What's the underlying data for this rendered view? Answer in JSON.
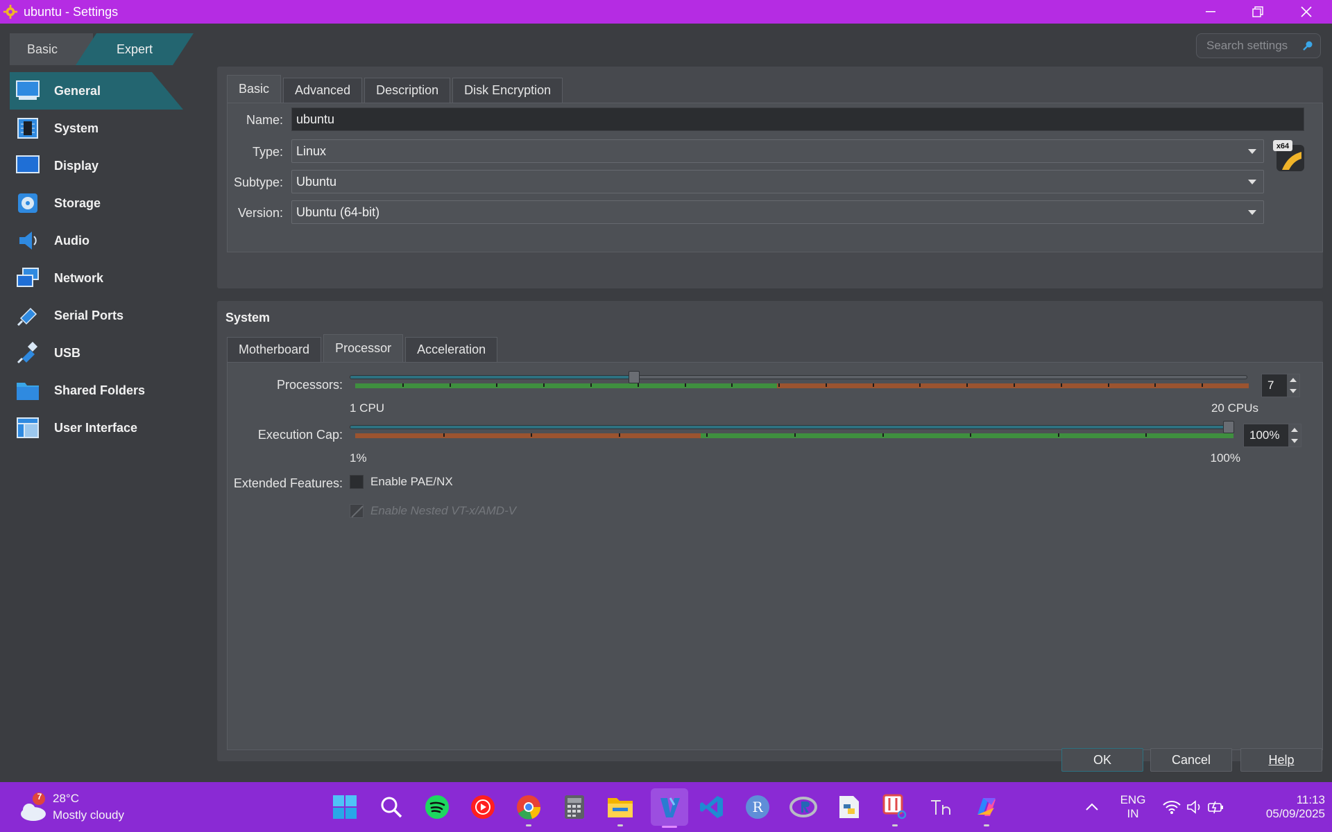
{
  "window": {
    "title": "ubuntu  - Settings"
  },
  "mode": {
    "basic": "Basic",
    "expert": "Expert"
  },
  "search": {
    "placeholder": "Search settings"
  },
  "sidebar": {
    "items": [
      {
        "label": "General",
        "icon": "general-icon"
      },
      {
        "label": "System",
        "icon": "system-icon"
      },
      {
        "label": "Display",
        "icon": "display-icon"
      },
      {
        "label": "Storage",
        "icon": "storage-icon"
      },
      {
        "label": "Audio",
        "icon": "audio-icon"
      },
      {
        "label": "Network",
        "icon": "network-icon"
      },
      {
        "label": "Serial Ports",
        "icon": "serial-ports-icon"
      },
      {
        "label": "USB",
        "icon": "usb-icon"
      },
      {
        "label": "Shared Folders",
        "icon": "shared-folders-icon"
      },
      {
        "label": "User Interface",
        "icon": "user-interface-icon"
      }
    ],
    "active": "General"
  },
  "general": {
    "tabs": [
      "Basic",
      "Advanced",
      "Description",
      "Disk Encryption"
    ],
    "active_tab": "Basic",
    "name_label": "Name:",
    "name_value": "ubuntu",
    "type_label": "Type:",
    "type_value": "Linux",
    "subtype_label": "Subtype:",
    "subtype_value": "Ubuntu",
    "version_label": "Version:",
    "version_value": "Ubuntu (64-bit)",
    "os_badge": "x64"
  },
  "system": {
    "title": "System",
    "tabs": [
      "Motherboard",
      "Processor",
      "Acceleration"
    ],
    "active_tab": "Processor",
    "processors_label": "Processors:",
    "processors_value": "7",
    "processors_min": "1 CPU",
    "processors_max": "20 CPUs",
    "processors_level": 7,
    "processors_range": [
      1,
      20
    ],
    "exec_cap_label": "Execution Cap:",
    "exec_cap_value": "100%",
    "exec_cap_min": "1%",
    "exec_cap_max": "100%",
    "exec_cap_level": 100,
    "ext_features_label": "Extended Features:",
    "pae_label": "Enable PAE/NX",
    "nested_label": "Enable Nested VT-x/AMD-V"
  },
  "buttons": {
    "ok": "OK",
    "cancel": "Cancel",
    "help": "Help"
  },
  "taskbar": {
    "weather_temp": "28°C",
    "weather_desc": "Mostly cloudy",
    "weather_badge": "7",
    "lang_1": "ENG",
    "lang_2": "IN",
    "time": "11:13",
    "date": "05/09/2025"
  },
  "colors": {
    "accent": "#236570",
    "titlebar": "#b52ce3",
    "taskbar": "#8a2ad4",
    "green_zone": "#3f8f3f",
    "red_zone": "#9b5430"
  }
}
